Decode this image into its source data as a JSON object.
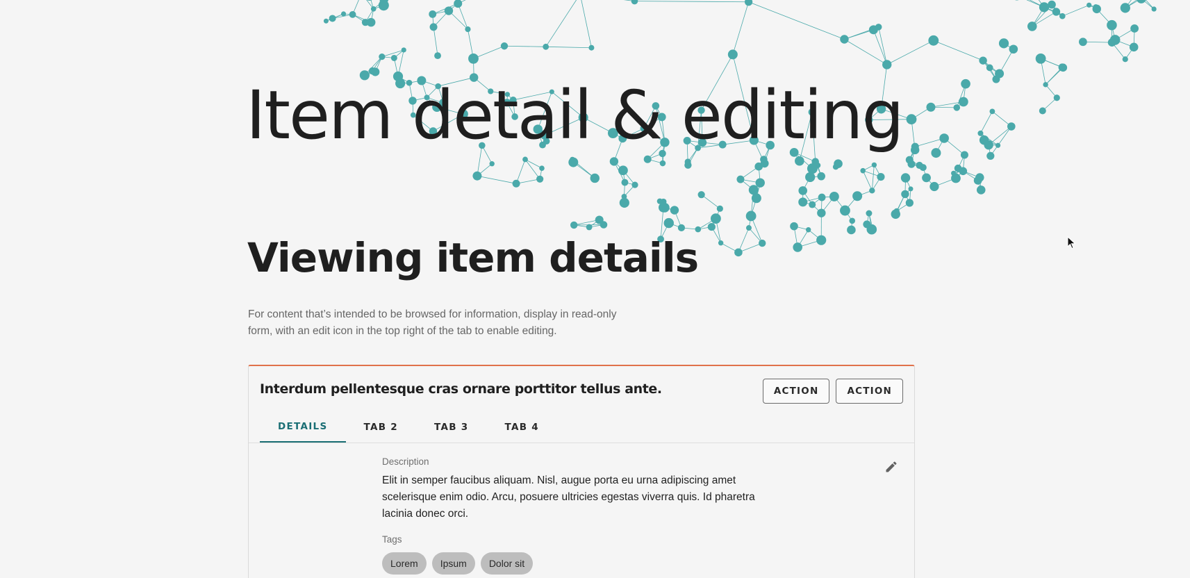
{
  "hero": {
    "title": "Item detail & editing"
  },
  "section": {
    "title": "Viewing item details",
    "intro": "For content that’s intended to be browsed for information, display in read-only form, with an edit icon in the top right of the tab to enable editing."
  },
  "card": {
    "title": "Interdum pellentesque cras ornare porttitor tellus ante.",
    "accent_color": "#e0714a",
    "actions": [
      "ACTION",
      "ACTION"
    ],
    "tabs": [
      {
        "label": "DETAILS",
        "active": true
      },
      {
        "label": "TAB 2",
        "active": false
      },
      {
        "label": "TAB 3",
        "active": false
      },
      {
        "label": "TAB 4",
        "active": false
      }
    ],
    "active_tab_color": "#1a6e74",
    "edit_icon": "pencil-icon",
    "description": {
      "label": "Description",
      "value": "Elit in semper faucibus aliquam. Nisl, augue porta eu urna adipiscing amet scelerisque enim odio. Arcu, posuere ultricies egestas viverra quis. Id pharetra lacinia donec orci."
    },
    "tags": {
      "label": "Tags",
      "items": [
        "Lorem",
        "Ipsum",
        "Dolor sit"
      ]
    }
  },
  "decoration": {
    "network_color": "#4aa9aa"
  }
}
